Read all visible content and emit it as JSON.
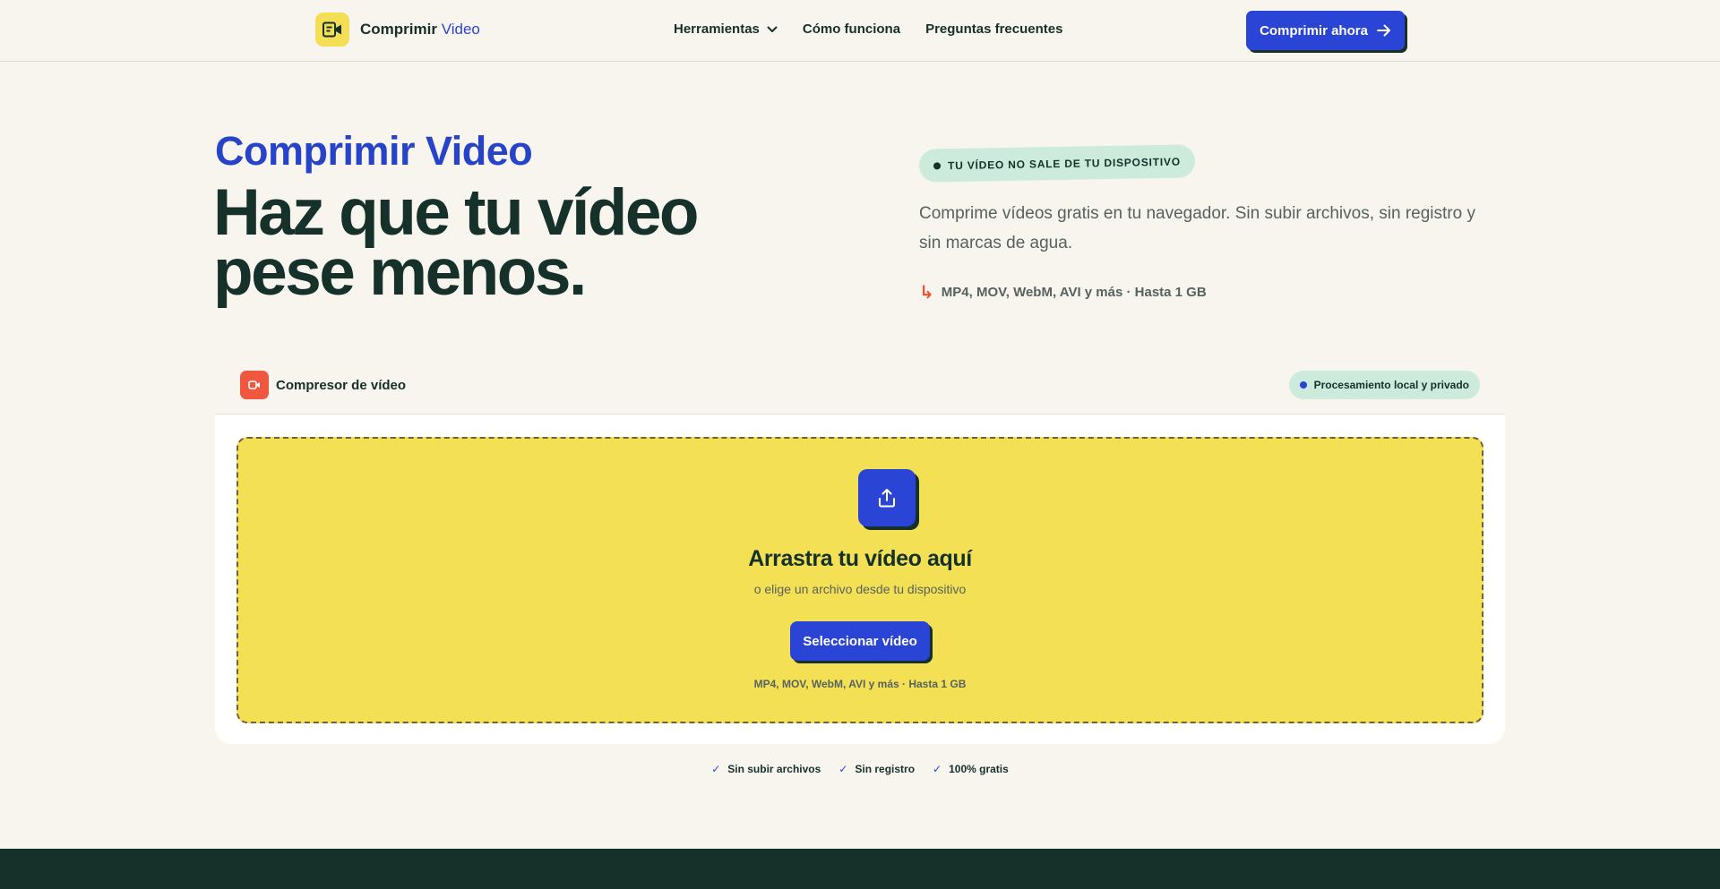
{
  "header": {
    "brand_main": "Comprimir",
    "brand_accent": "Video",
    "nav": [
      {
        "label": "Herramientas",
        "has_dropdown": true
      },
      {
        "label": "Cómo funciona"
      },
      {
        "label": "Preguntas frecuentes"
      }
    ],
    "cta_label": "Comprimir ahora"
  },
  "hero": {
    "eyebrow": "Comprimir Video",
    "headline": "Haz que tu vídeo pese menos.",
    "privacy_badge": "TU VÍDEO NO SALE DE TU DISPOSITIVO",
    "intro": "Comprime vídeos gratis en tu navegador. Sin subir archivos, sin registro y sin marcas de agua.",
    "formats_arrow": "↳",
    "formats": "MP4, MOV, WebM, AVI y más · Hasta 1 GB"
  },
  "tool": {
    "title": "Compresor de vídeo",
    "local_badge": "Procesamiento local y privado",
    "dropzone": {
      "title": "Arrastra tu vídeo aquí",
      "subtitle": "o elige un archivo desde tu dispositivo",
      "button": "Seleccionar vídeo",
      "formats": "MP4, MOV, WebM, AVI y más · Hasta 1 GB"
    }
  },
  "features": [
    {
      "check": "✓",
      "label": "Sin subir archivos"
    },
    {
      "check": "✓",
      "label": "Sin registro"
    },
    {
      "check": "✓",
      "label": "100% gratis"
    }
  ],
  "colors": {
    "background": "#f8f4ee",
    "primary": "#2a44d6",
    "dark": "#16302a",
    "yellow": "#f4e055",
    "mint": "#cdebdd",
    "coral": "#ef583f"
  },
  "icons": {
    "logo": "video-note-icon",
    "dropdown": "chevron-down-icon",
    "cta": "arrow-right-icon",
    "tool": "video-camera-icon",
    "upload": "upload-icon"
  }
}
